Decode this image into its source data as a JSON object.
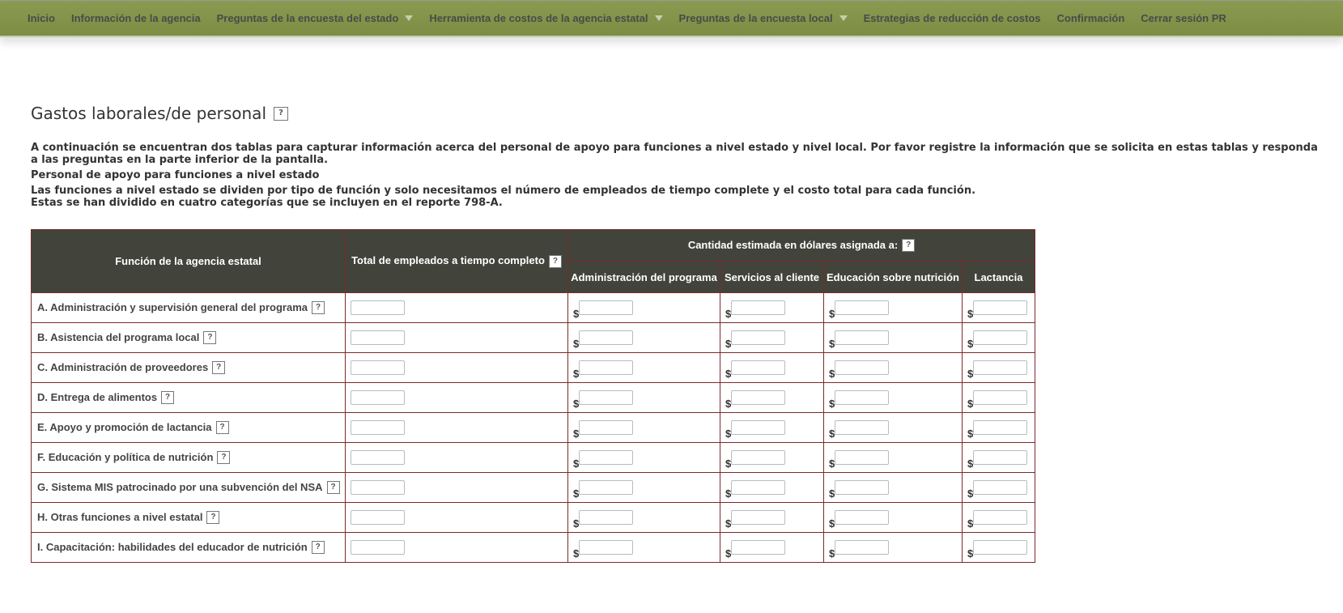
{
  "nav": {
    "items": [
      {
        "label": "Inicio",
        "dropdown": false
      },
      {
        "label": "Información de la agencia",
        "dropdown": false
      },
      {
        "label": "Preguntas de la encuesta del estado",
        "dropdown": true
      },
      {
        "label": "Herramienta de costos de la agencia estatal",
        "dropdown": true
      },
      {
        "label": "Preguntas de la encuesta local",
        "dropdown": true
      },
      {
        "label": "Estrategias de reducción de costos",
        "dropdown": false
      },
      {
        "label": "Confirmación",
        "dropdown": false
      },
      {
        "label": "Cerrar sesión PR",
        "dropdown": false
      }
    ]
  },
  "page": {
    "title": "Gastos laborales/de personal",
    "help": "?",
    "intro": [
      "A continuación se encuentran dos tablas para capturar información acerca del personal de apoyo para funciones a nivel estado y nivel local. Por favor registre la información que se solicita en estas tablas y responda a las preguntas en la parte inferior de la pantalla.",
      "Personal de apoyo para funciones a nivel estado",
      "Las funciones a nivel estado se dividen por tipo de función y solo necesitamos el número de empleados de tiempo complete y el costo total para cada función.",
      "Estas se han dividido en cuatro categorías que se incluyen en el reporte 798-A."
    ]
  },
  "table": {
    "col_function": "Función de la agencia estatal",
    "col_fte": "Total de empleados a tiempo completo",
    "col_group": "Cantidad estimada en dólares asignada a:",
    "subcols": [
      "Administración del programa",
      "Servicios al cliente",
      "Educación sobre nutrición",
      "Lactancia"
    ],
    "currency": "$",
    "help": "?",
    "rows": [
      "A. Administración y supervisión general del programa",
      "B. Asistencia del programa local",
      "C. Administración de proveedores",
      "D. Entrega de alimentos",
      "E. Apoyo y promoción de lactancia",
      "F. Educación y política de nutrición",
      "G. Sistema MIS patrocinado por una subvención del NSA",
      "H. Otras funciones a nivel estatal",
      "I. Capacitación: habilidades del educador de nutrición"
    ]
  }
}
